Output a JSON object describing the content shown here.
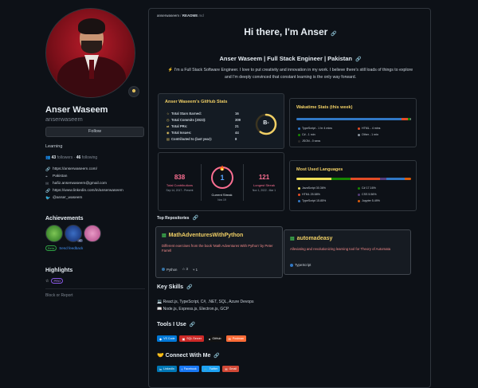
{
  "profile": {
    "name": "Anser Waseem",
    "username": "anserwaseem",
    "follow_label": "Follow",
    "bio": "Learning",
    "followers_count": "43",
    "followers_label": "followers",
    "following_count": "46",
    "following_label": "following",
    "details": [
      {
        "icon": "link-icon",
        "glyph": "🔗",
        "text": "https://anserwaseem.com/"
      },
      {
        "icon": "location-icon",
        "glyph": "⌖",
        "text": "Pakistan"
      },
      {
        "icon": "mail-icon",
        "glyph": "✉",
        "text": "hafiz.anserwaseem@gmail.com"
      },
      {
        "icon": "linkedin-icon",
        "glyph": "🔗",
        "text": "https://www.linkedin.com/in/anserwaseem"
      },
      {
        "icon": "twitter-icon",
        "glyph": "🐦",
        "text": "@anser_waseem"
      }
    ],
    "achievements_title": "Achievements",
    "achievement_multiplier": "x2",
    "beta_label": "Beta",
    "feedback_label": "Send feedback",
    "highlights_title": "Highlights",
    "pro_label": "PRO",
    "block_label": "Block or Report"
  },
  "readme": {
    "path_user": "anserwaseem",
    "path_sep": " / ",
    "path_file": "README",
    "path_ext": ".md",
    "heading": "Hi there, I'm Anser",
    "subheading": "Anser Waseem | Full Stack Engineer | Pakistan",
    "intro": "⚡ I'm a Full Stack Software Engineer. I love to put creativity and innovation in my work. I believe there's still loads of things to explore and I'm deeply convinced that constant learning is the only way forward.",
    "github_stats": {
      "title": "Anser Waseem's GitHub Stats",
      "rows": [
        {
          "label": "Total Stars Earned:",
          "value": "16",
          "glyph": "☆"
        },
        {
          "label": "Total Commits (2023):",
          "value": "309",
          "glyph": "◷"
        },
        {
          "label": "Total PRs:",
          "value": "21",
          "glyph": "⇄"
        },
        {
          "label": "Total Issues:",
          "value": "44",
          "glyph": "◉"
        },
        {
          "label": "Contributed to (last year):",
          "value": "8",
          "glyph": "▤"
        }
      ],
      "grade": "B-",
      "grade_progress": 0.6
    },
    "wakatime": {
      "title": "Wakatime Stats (this week)",
      "legend": [
        {
          "label": "TypeScript - 1 hr 4 mins",
          "color": "#3178c6"
        },
        {
          "label": "HTML - 4 mins",
          "color": "#e34c26"
        },
        {
          "label": "C# - 1 min",
          "color": "#178600"
        },
        {
          "label": "Other - 1 min",
          "color": "#8b949e"
        },
        {
          "label": "JSON - 0 secs",
          "color": "#292929"
        }
      ]
    },
    "streak": {
      "total": {
        "value": "838",
        "label": "Total Contributions",
        "range": "Sep 14, 2017 - Present"
      },
      "current": {
        "value": "1",
        "label": "Current Streak",
        "range": "Nov 19"
      },
      "longest": {
        "value": "121",
        "label": "Longest Streak",
        "range": "Nov 1, 2022 - Mar 1"
      }
    },
    "languages": {
      "title": "Most Used Languages",
      "legend": [
        {
          "label": "JavaScript 30.36%",
          "color": "#f1e05a",
          "value": 30.36
        },
        {
          "label": "C# 17.16%",
          "color": "#178600",
          "value": 17.16
        },
        {
          "label": "HTML 25.58%",
          "color": "#e34c26",
          "value": 25.58
        },
        {
          "label": "CSS 5.56%",
          "color": "#563d7c",
          "value": 5.56
        },
        {
          "label": "TypeScript 15.85%",
          "color": "#3178c6",
          "value": 15.85
        },
        {
          "label": "Jupyter 5.49%",
          "color": "#da5b0b",
          "value": 5.49
        }
      ]
    },
    "top_repos_label": "Top Repositories",
    "repos": [
      {
        "name": "MathAdventuresWithPython",
        "description": "Different exercises from the book 'Math Adventures With Python' by Peter Farrell",
        "language": "Python",
        "language_color": "#3572a5",
        "stars": "3",
        "forks": "1"
      },
      {
        "name": "automadeasy",
        "description": "Alleviating and revolutionizing learning tool for Theory of Automata",
        "language": "TypeScript",
        "language_color": "#3178c6"
      }
    ],
    "key_skills_title": "Key Skills",
    "skills": [
      {
        "glyph": "💻",
        "text": "React.js, TypeScript, C#, .NET, SQL, Azure Devops"
      },
      {
        "glyph": "📖",
        "text": "Node.js, Express.js, Electron.js, GCP"
      }
    ],
    "tools_title": "Tools I Use",
    "tools": [
      {
        "label": "VS Code",
        "color": "#0078d7",
        "glyph": "◆"
      },
      {
        "label": "SQL Server",
        "color": "#cc2927",
        "glyph": "▣"
      },
      {
        "label": "GitHub",
        "color": "#121212",
        "glyph": "●"
      },
      {
        "label": "Postman",
        "color": "#ff6c37",
        "glyph": "✉"
      }
    ],
    "connect_title": "Connect With Me",
    "socials": [
      {
        "label": "LinkedIn",
        "color": "#0077b5",
        "glyph": "in"
      },
      {
        "label": "Facebook",
        "color": "#1877f2",
        "glyph": "f"
      },
      {
        "label": "Twitter",
        "color": "#1da1f2",
        "glyph": "🐦"
      },
      {
        "label": "Gmail",
        "color": "#d14836",
        "glyph": "✉"
      }
    ]
  }
}
